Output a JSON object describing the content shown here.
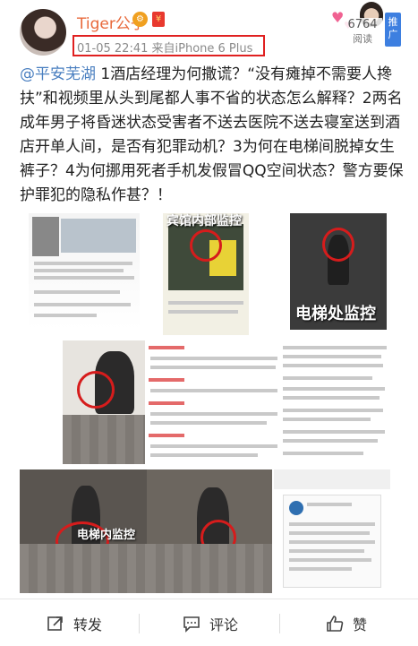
{
  "header": {
    "username": "Tiger公子",
    "vip_badge": "⚙",
    "red_badge": "¥",
    "meta": "01-05 22:41  来自iPhone 6 Plus",
    "read_count": "6764",
    "read_label": "阅读",
    "promote_label": "推广"
  },
  "post": {
    "mention": "@平安芜湖",
    "text": " 1酒店经理为何撒谎？“没有瘫掉不需要人搀扶”和视频里从头到尾都人事不省的状态怎么解释？2两名成年男子将昏迷状态受害者不送去医院不送去寝室送到酒店开单人间，是否有犯罪动机？3为何在电梯间脱掉女生裤子？4为何挪用死者手机发假冒QQ空间状态？警方要保护罪犯的隐私作甚？！"
  },
  "images": {
    "i2_caption": "宾馆内部监控",
    "i3_caption": "电梯处监控",
    "i7_caption": "电梯内监控"
  },
  "actions": {
    "repost": "转发",
    "comment": "评论",
    "like": "赞"
  },
  "colors": {
    "accent_orange": "#e8693b",
    "link_blue": "#4a7fc0",
    "highlight_red": "#e02020"
  }
}
